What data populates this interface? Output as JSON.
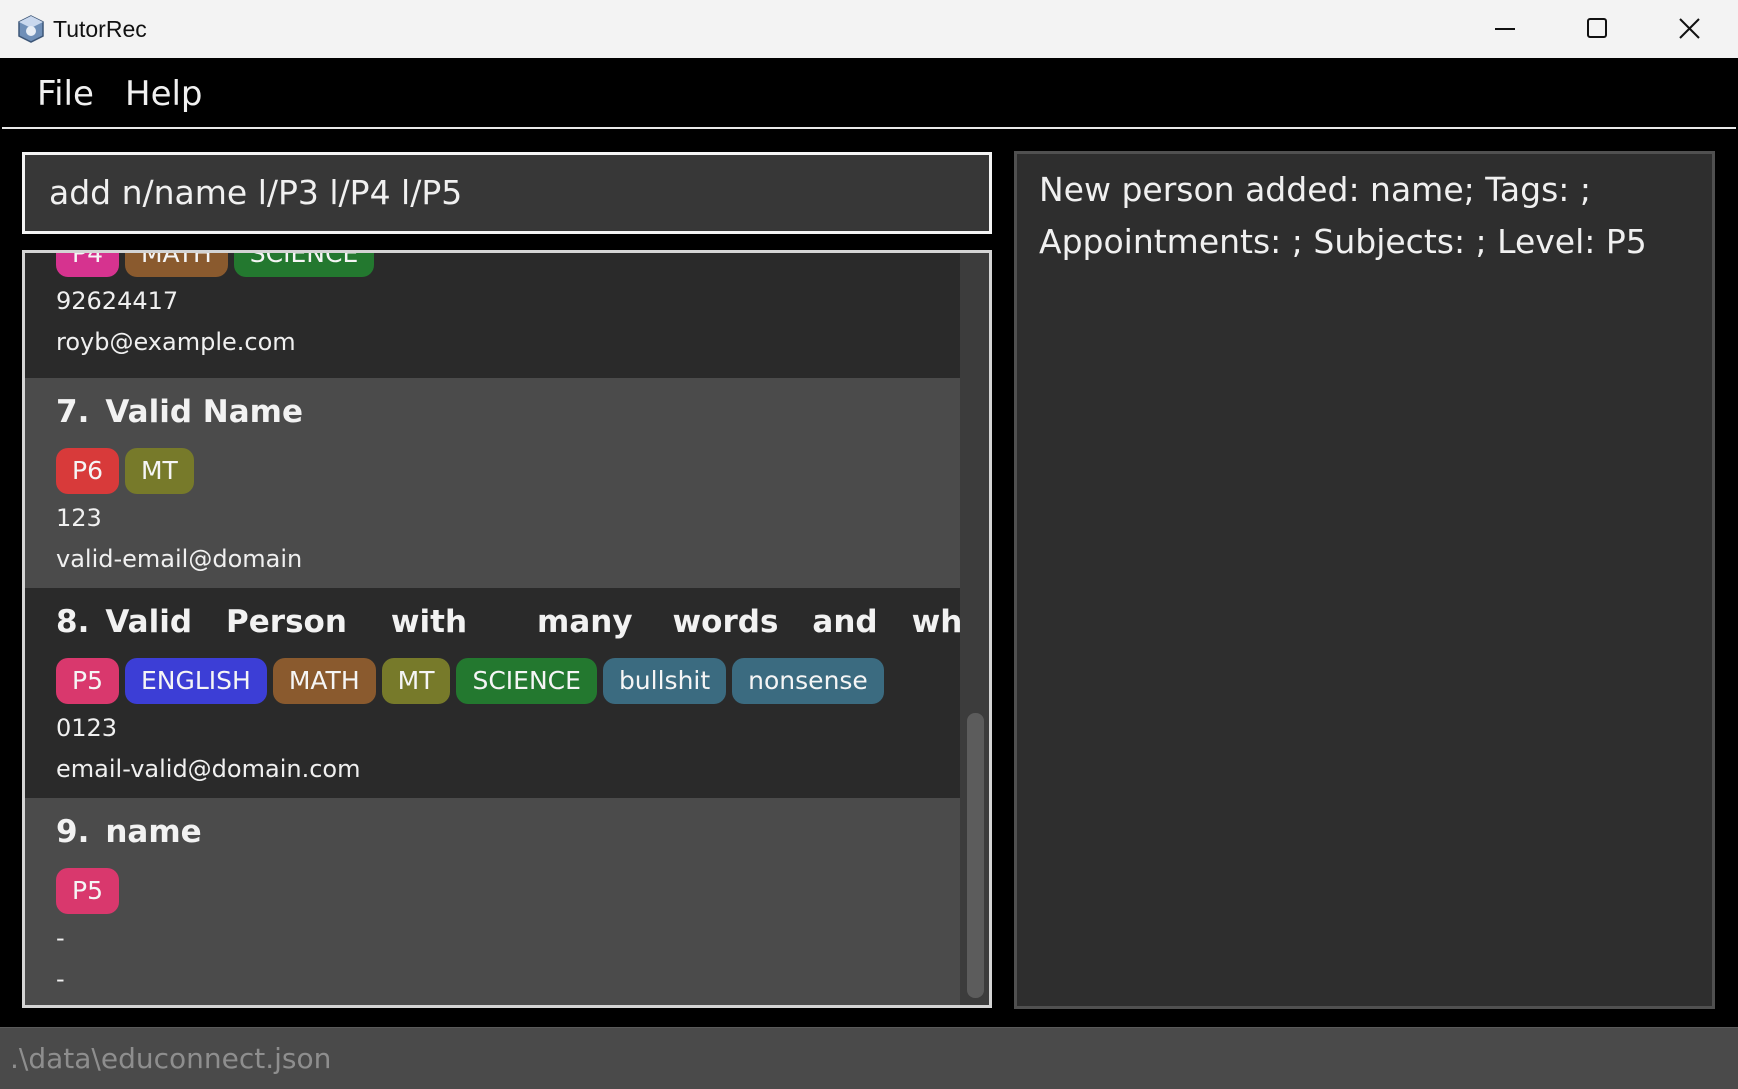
{
  "window": {
    "title": "TutorRec"
  },
  "menu": {
    "file": "File",
    "help": "Help"
  },
  "command_box": {
    "value": "add n/name l/P3 l/P4 l/P5"
  },
  "result_display": {
    "line1": "New person added: name; Tags: ;",
    "line2": "Appointments: ; Subjects: ; Level: P5"
  },
  "persons": [
    {
      "index": "",
      "name": "",
      "tags": [
        {
          "label": "P4",
          "color": "#d6338f"
        },
        {
          "label": "MATH",
          "color": "#8a5a2e"
        },
        {
          "label": "SCIENCE",
          "color": "#23782f"
        }
      ],
      "phone": "92624417",
      "email": "royb@example.com"
    },
    {
      "index": "7.",
      "name": "Valid Name",
      "tags": [
        {
          "label": "P6",
          "color": "#d83a3a"
        },
        {
          "label": "MT",
          "color": "#777a2a"
        }
      ],
      "phone": "123",
      "email": "valid-email@domain"
    },
    {
      "index": "8.",
      "name_words": [
        "Valid",
        "Person",
        "with",
        "many",
        "words",
        "and",
        "whites..."
      ],
      "tags": [
        {
          "label": "P5",
          "color": "#d9386d"
        },
        {
          "label": "ENGLISH",
          "color": "#3c3ed6"
        },
        {
          "label": "MATH",
          "color": "#8a5a2e"
        },
        {
          "label": "MT",
          "color": "#777a2a"
        },
        {
          "label": "SCIENCE",
          "color": "#23782f"
        },
        {
          "label": "bullshit",
          "color": "#3b6b80"
        },
        {
          "label": "nonsense",
          "color": "#3b6b80"
        }
      ],
      "phone": "0123",
      "email": "email-valid@domain.com"
    },
    {
      "index": "9.",
      "name": "name",
      "tags": [
        {
          "label": "P5",
          "color": "#d9386d"
        }
      ],
      "phone": "-",
      "email": "-"
    }
  ],
  "status_bar": {
    "path": ".\\data\\educonnect.json"
  },
  "colors": {
    "background": "#000000",
    "panel": "#2e2e2e",
    "card_dark": "#2a2a2a",
    "card_light": "#4b4b4b",
    "text": "#f0f0f0"
  },
  "icons": [
    "app-icon",
    "minimize-icon",
    "maximize-icon",
    "close-icon"
  ]
}
